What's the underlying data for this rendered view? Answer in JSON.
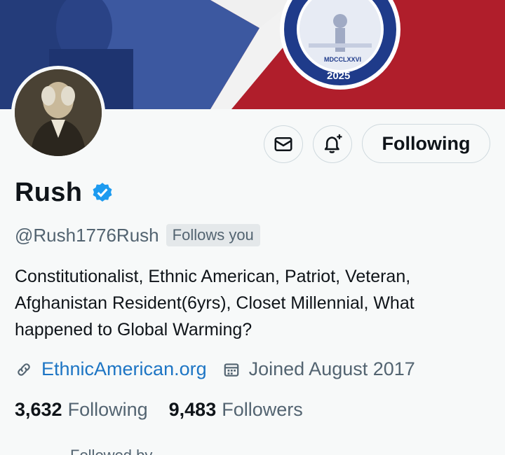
{
  "banner": {
    "seal_year": "2025",
    "seal_roman": "MDCCLXXVI",
    "blue": "#2f4a92",
    "red": "#b01e2b"
  },
  "profile": {
    "name": "Rush",
    "handle": "@Rush1776Rush",
    "follows_you": "Follows you",
    "bio": "Constitutionalist, Ethnic American, Patriot, Veteran, Afghanistan Resident(6yrs), Closet Millennial, What happened to Global Warming?",
    "website": "EthnicAmerican.org",
    "joined": "Joined August 2017"
  },
  "actions": {
    "message_icon": "envelope-icon",
    "notify_icon": "bell-plus-icon",
    "following_label": "Following"
  },
  "stats": {
    "following_count": "3,632",
    "following_label": "Following",
    "followers_count": "9,483",
    "followers_label": "Followers"
  },
  "footer": {
    "followed_by_partial": "Followed by"
  }
}
